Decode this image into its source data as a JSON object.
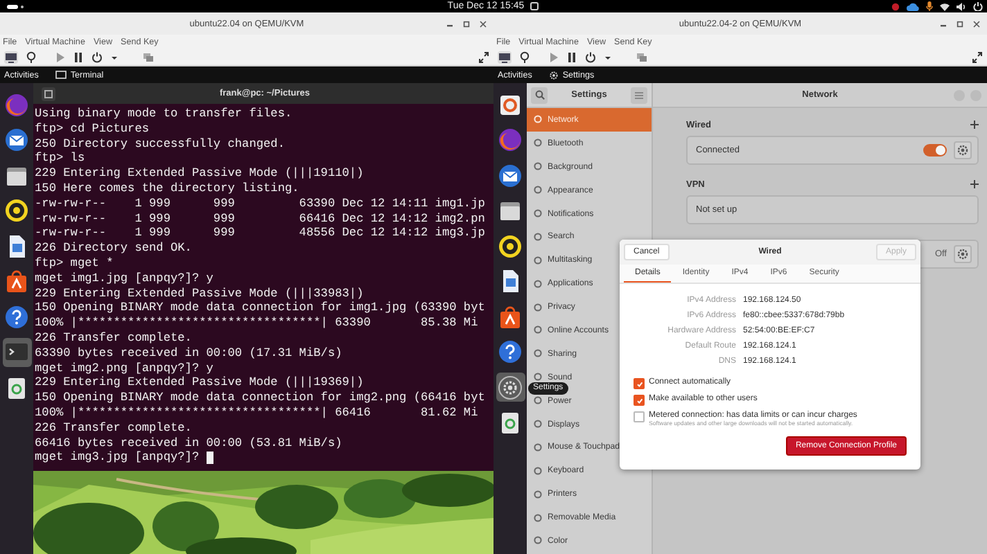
{
  "top_bar": {
    "clock": "Tue Dec 12 15:45"
  },
  "vms": [
    {
      "kind": "terminal",
      "title": "ubuntu22.04 on QEMU/KVM",
      "menu": [
        "File",
        "Virtual Machine",
        "View",
        "Send Key"
      ],
      "guest": {
        "activities": "Activities",
        "app": "Terminal",
        "dock": [
          {
            "kind": "browser",
            "selected": false
          },
          {
            "kind": "mail",
            "selected": false
          },
          {
            "kind": "files",
            "selected": false
          },
          {
            "kind": "music",
            "selected": false
          },
          {
            "kind": "document",
            "selected": false
          },
          {
            "kind": "store",
            "selected": false
          },
          {
            "kind": "help",
            "selected": false
          },
          {
            "kind": "terminal",
            "selected": true
          },
          {
            "kind": "trash",
            "selected": false
          }
        ],
        "terminal": {
          "title": "frank@pc: ~/Pictures",
          "cursor": true,
          "lines": [
            "Using binary mode to transfer files.",
            "ftp> cd Pictures",
            "250 Directory successfully changed.",
            "ftp> ls",
            "229 Entering Extended Passive Mode (|||19110|)",
            "150 Here comes the directory listing.",
            "-rw-rw-r--    1 999      999         63390 Dec 12 14:11 img1.jp",
            "-rw-rw-r--    1 999      999         66416 Dec 12 14:12 img2.pn",
            "-rw-rw-r--    1 999      999         48556 Dec 12 14:12 img3.jp",
            "226 Directory send OK.",
            "ftp> mget *",
            "mget img1.jpg [anpqy?]? y",
            "229 Entering Extended Passive Mode (|||33983|)",
            "150 Opening BINARY mode data connection for img1.jpg (63390 byt",
            "100% |**********************************| 63390       85.38 Mi",
            "226 Transfer complete.",
            "63390 bytes received in 00:00 (17.31 MiB/s)",
            "mget img2.png [anpqy?]? y",
            "229 Entering Extended Passive Mode (|||19369|)",
            "150 Opening BINARY mode data connection for img2.png (66416 byt",
            "100% |**********************************| 66416       81.62 Mi",
            "226 Transfer complete.",
            "66416 bytes received in 00:00 (53.81 MiB/s)",
            "mget img3.jpg [anpqy?]? "
          ]
        }
      }
    },
    {
      "kind": "settings",
      "title": "ubuntu22.04-2 on QEMU/KVM",
      "menu": [
        "File",
        "Virtual Machine",
        "View",
        "Send Key"
      ],
      "guest": {
        "activities": "Activities",
        "app": "Settings",
        "tooltip": "Settings",
        "dock": [
          {
            "kind": "tile",
            "selected": false
          },
          {
            "kind": "browser",
            "selected": false
          },
          {
            "kind": "mail",
            "selected": false
          },
          {
            "kind": "files",
            "selected": false
          },
          {
            "kind": "music",
            "selected": false
          },
          {
            "kind": "document",
            "selected": false
          },
          {
            "kind": "store",
            "selected": false
          },
          {
            "kind": "help",
            "selected": false
          },
          {
            "kind": "settings",
            "selected": true
          },
          {
            "kind": "trash",
            "selected": false
          }
        ],
        "settings": {
          "title": "Settings",
          "categories": [
            {
              "label": "Network",
              "selected": true
            },
            {
              "label": "Bluetooth",
              "selected": false
            },
            {
              "label": "Background",
              "selected": false
            },
            {
              "label": "Appearance",
              "selected": false
            },
            {
              "label": "Notifications",
              "selected": false
            },
            {
              "label": "Search",
              "selected": false
            },
            {
              "label": "Multitasking",
              "selected": false
            },
            {
              "label": "Applications",
              "selected": false
            },
            {
              "label": "Privacy",
              "selected": false
            },
            {
              "label": "Online Accounts",
              "selected": false
            },
            {
              "label": "Sharing",
              "selected": false
            },
            {
              "label": "Sound",
              "selected": false
            },
            {
              "label": "Power",
              "selected": false
            },
            {
              "label": "Displays",
              "selected": false
            },
            {
              "label": "Mouse & Touchpad",
              "selected": false
            },
            {
              "label": "Keyboard",
              "selected": false
            },
            {
              "label": "Printers",
              "selected": false
            },
            {
              "label": "Removable Media",
              "selected": false
            },
            {
              "label": "Color",
              "selected": false
            }
          ],
          "panel_title": "Network",
          "sections": [
            {
              "kind": "switch",
              "heading": "Wired",
              "label": "Connected",
              "on": true
            },
            {
              "kind": "note",
              "heading": "VPN",
              "label": "Not set up"
            },
            {
              "kind": "value",
              "value": "Off"
            }
          ],
          "dialog": {
            "cancel": "Cancel",
            "title": "Wired",
            "apply": {
              "label": "Apply",
              "disabled": true
            },
            "tabs": [
              {
                "label": "Details",
                "selected": true
              },
              {
                "label": "Identity",
                "selected": false
              },
              {
                "label": "IPv4",
                "selected": false
              },
              {
                "label": "IPv6",
                "selected": false
              },
              {
                "label": "Security",
                "selected": false
              }
            ],
            "details": [
              {
                "label": "IPv4 Address",
                "value": "192.168.124.50"
              },
              {
                "label": "IPv6 Address",
                "value": "fe80::cbee:5337:678d:79bb"
              },
              {
                "label": "Hardware Address",
                "value": "52:54:00:BE:EF:C7"
              },
              {
                "label": "Default Route",
                "value": "192.168.124.1"
              },
              {
                "label": "DNS",
                "value": "192.168.124.1"
              }
            ],
            "options": [
              {
                "label": "Connect automatically",
                "checked": true
              },
              {
                "label": "Make available to other users",
                "checked": true
              },
              {
                "label": "Metered connection: has data limits or can incur charges",
                "note": "Software updates and other large downloads will not be started automatically.",
                "checked": false
              }
            ],
            "remove": "Remove Connection Profile"
          }
        }
      }
    }
  ]
}
